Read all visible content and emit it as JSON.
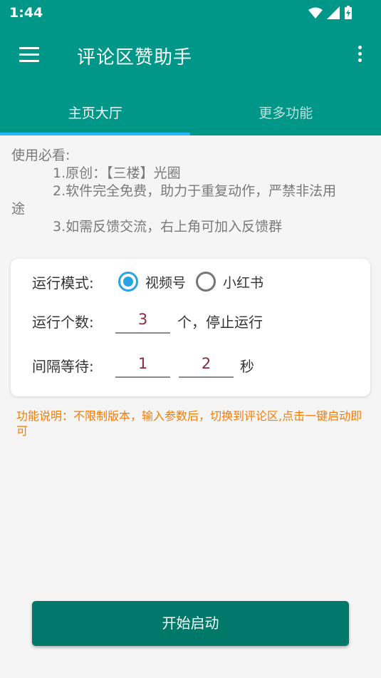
{
  "status": {
    "time": "1:44"
  },
  "toolbar": {
    "title": "评论区赞助手"
  },
  "tabs": [
    {
      "label": "主页大厅",
      "active": true
    },
    {
      "label": "更多功能",
      "active": false
    }
  ],
  "notice": {
    "heading": "使用必看:",
    "items": [
      "1.原创：【三楼】光圈",
      "2.软件完全免费，助力于重复动作，严禁非法用",
      "途",
      "3.如需反馈交流，右上角可加入反馈群"
    ]
  },
  "settings": {
    "mode_label": "运行模式:",
    "mode_options": [
      "视频号",
      "小红书"
    ],
    "mode_selected": "视频号",
    "count_label": "运行个数:",
    "count_value": "3",
    "count_suffix": "个，停止运行",
    "interval_label": "间隔等待:",
    "interval_min": "1",
    "interval_max": "2",
    "interval_suffix": "秒"
  },
  "func_desc": "功能说明：不限制版本，输入参数后，切换到评论区,点击一键启动即可",
  "start_button": "开始启动",
  "colors": {
    "primary": "#009688",
    "accent": "#29b6f6",
    "button": "#00796b",
    "warning": "#f57c00"
  }
}
